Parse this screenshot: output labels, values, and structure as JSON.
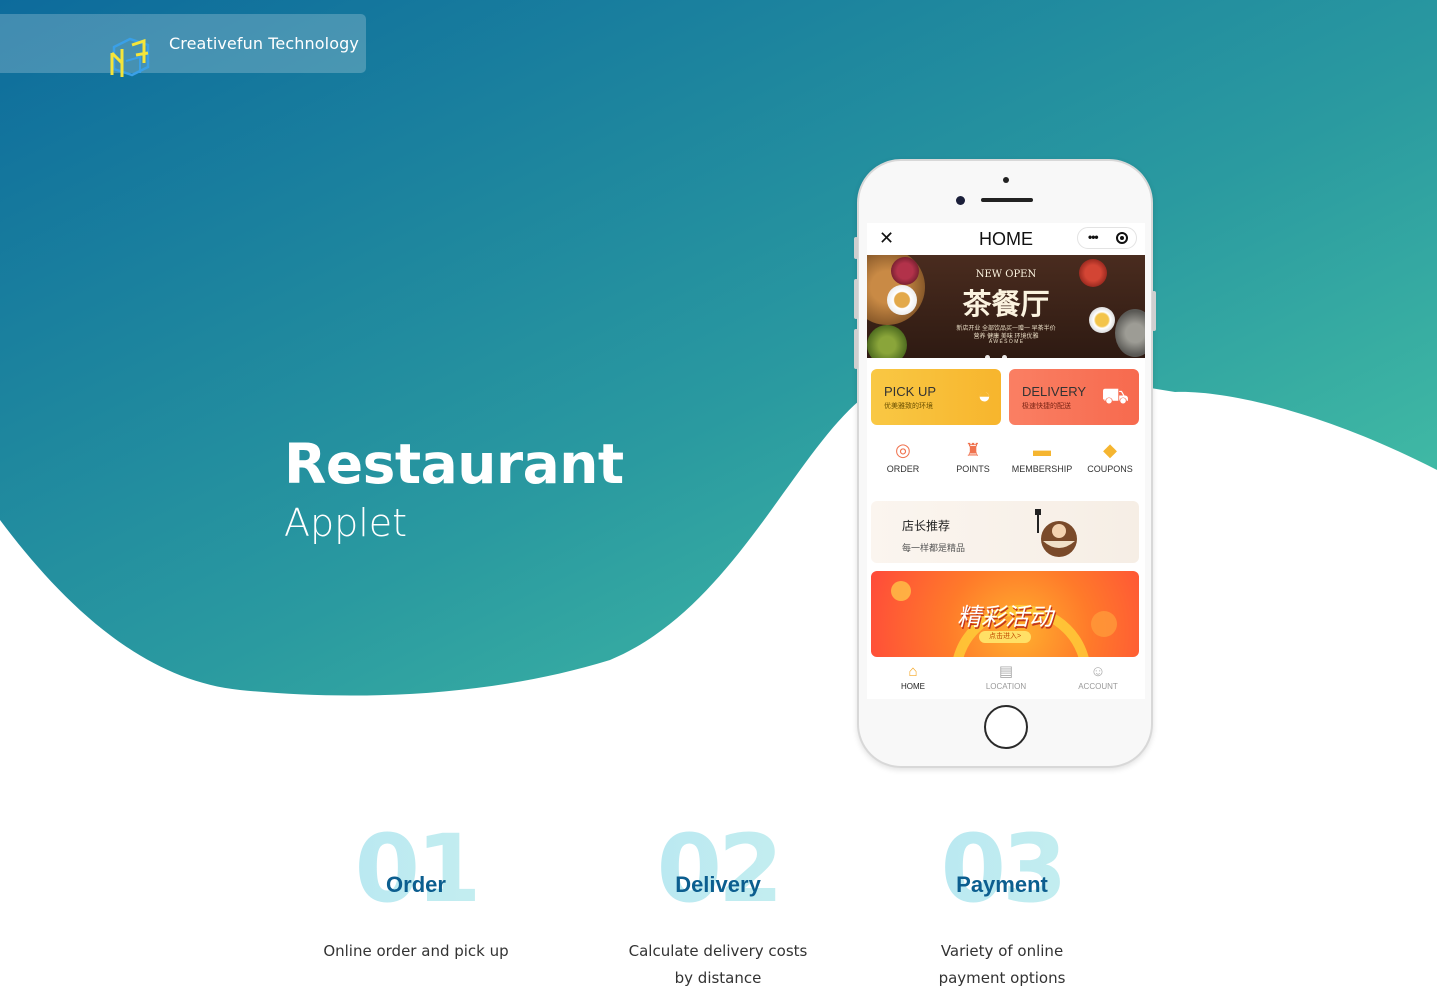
{
  "brand": {
    "name": "Creativefun Technology",
    "logo_icon": "cube-logo-icon"
  },
  "hero": {
    "title": "Restaurant",
    "subtitle": "Applet"
  },
  "phone": {
    "nav": {
      "title": "HOME",
      "close_icon": "close-icon",
      "more_icon": "more-dots-icon",
      "target_icon": "record-icon"
    },
    "banner": {
      "headline_en": "NEW OPEN",
      "headline_cn": "茶餐厅",
      "tagline": "新店开业 全部饮品买一赠一 早茶半价",
      "tagline2": "营养 健康 美味 环境优雅",
      "welcome": "A W E S O M E"
    },
    "cards": [
      {
        "title": "PICK UP",
        "subtitle": "优美雅致的环境",
        "icon": "rice-bowl-icon",
        "color": "#f7c843"
      },
      {
        "title": "DELIVERY",
        "subtitle": "极速快捷的配送",
        "icon": "scooter-icon",
        "color": "#f8775a"
      }
    ],
    "quick_menu": [
      {
        "label": "ORDER",
        "icon": "order-icon",
        "color": "#f0734f"
      },
      {
        "label": "POINTS",
        "icon": "points-bag-icon",
        "color": "#f0734f"
      },
      {
        "label": "MEMBERSHIP",
        "icon": "membership-card-icon",
        "color": "#f5b530"
      },
      {
        "label": "COUPONS",
        "icon": "coupon-tag-icon",
        "color": "#f5b530"
      }
    ],
    "recommend": {
      "title": "店长推荐",
      "subtitle": "每一样都是精品"
    },
    "event": {
      "title": "精彩活动",
      "button": "点击进入>"
    },
    "tabs": [
      {
        "label": "HOME",
        "icon": "home-icon",
        "active": true
      },
      {
        "label": "LOCATION",
        "icon": "store-icon",
        "active": false
      },
      {
        "label": "ACCOUNT",
        "icon": "account-icon",
        "active": false
      }
    ],
    "accent_color": "#f5a623"
  },
  "features": [
    {
      "number": "01",
      "name": "Order",
      "description": "Online order and pick up"
    },
    {
      "number": "02",
      "name": "Delivery",
      "description": "Calculate delivery costs by distance"
    },
    {
      "number": "03",
      "name": "Payment",
      "description": "Variety of online payment options"
    }
  ],
  "colors": {
    "gradient_start": "#0d6b9c",
    "gradient_end": "#48c5a8",
    "feature_name": "#0c5e8f"
  }
}
